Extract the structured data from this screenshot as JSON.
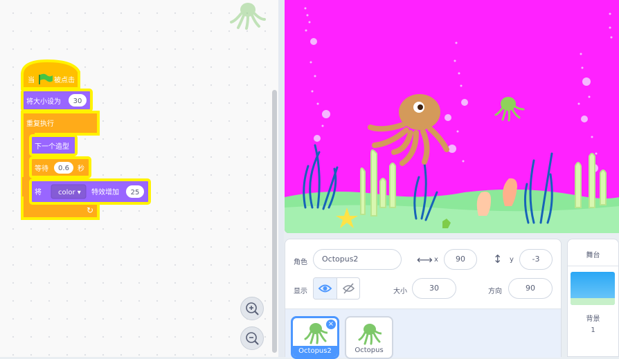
{
  "script": {
    "hat": {
      "before": "当",
      "after": "被点击"
    },
    "set_size": {
      "label": "将大小设为",
      "value": "30"
    },
    "forever": {
      "label": "重复执行"
    },
    "next_costume": {
      "label": "下一个造型"
    },
    "wait": {
      "label": "等待",
      "value": "0.6",
      "unit": "秒"
    },
    "change_effect": {
      "label_before": "将",
      "effect": "color ▾",
      "label_after": "特效增加",
      "value": "25"
    },
    "loop_arrow": "↻"
  },
  "zoom": {
    "in_icon": "zoom-in-icon",
    "out_icon": "zoom-out-icon"
  },
  "sprite_info": {
    "sprite_label": "角色",
    "sprite_name": "Octopus2",
    "x_label": "x",
    "x_value": "90",
    "y_label": "y",
    "y_value": "-3",
    "show_label": "显示",
    "size_label": "大小",
    "size_value": "30",
    "direction_label": "方向",
    "direction_value": "90"
  },
  "sprites": [
    {
      "name": "Octopus2",
      "selected": true
    },
    {
      "name": "Octopus",
      "selected": false
    }
  ],
  "stage_pane": {
    "title": "舞台",
    "backdrop_label": "背景",
    "backdrop_count": "1"
  },
  "colors": {
    "motion_blue": "#4c97ff",
    "control_orange": "#ffab19",
    "looks_purple": "#9966ff",
    "selected_blue": "#855cd6",
    "stage_magenta": "#ff22ff"
  }
}
